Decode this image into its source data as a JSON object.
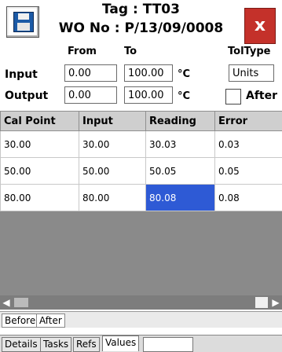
{
  "header": {
    "tag": "Tag : TT03",
    "wo": "WO No : P/13/09/0008",
    "close_label": "x"
  },
  "settings": {
    "from_label": "From",
    "to_label": "To",
    "toltype_label": "TolType",
    "input_label": "Input",
    "output_label": "Output",
    "input_from": "0.00",
    "input_to": "100.00",
    "input_unit": "°C",
    "output_from": "0.00",
    "output_to": "100.00",
    "output_unit": "°C",
    "toltype_value": "Units",
    "after_label": "After"
  },
  "table": {
    "headers": [
      "Cal Point",
      "Input",
      "Reading",
      "Error"
    ],
    "rows": [
      [
        "30.00",
        "30.00",
        "30.03",
        "0.03"
      ],
      [
        "50.00",
        "50.00",
        "50.05",
        "0.05"
      ],
      [
        "80.00",
        "80.00",
        "80.08",
        "0.08"
      ]
    ]
  },
  "subtabs": [
    "Before",
    "After"
  ],
  "bottom_tabs": [
    "Details",
    "Tasks",
    "Refs",
    "Values"
  ]
}
